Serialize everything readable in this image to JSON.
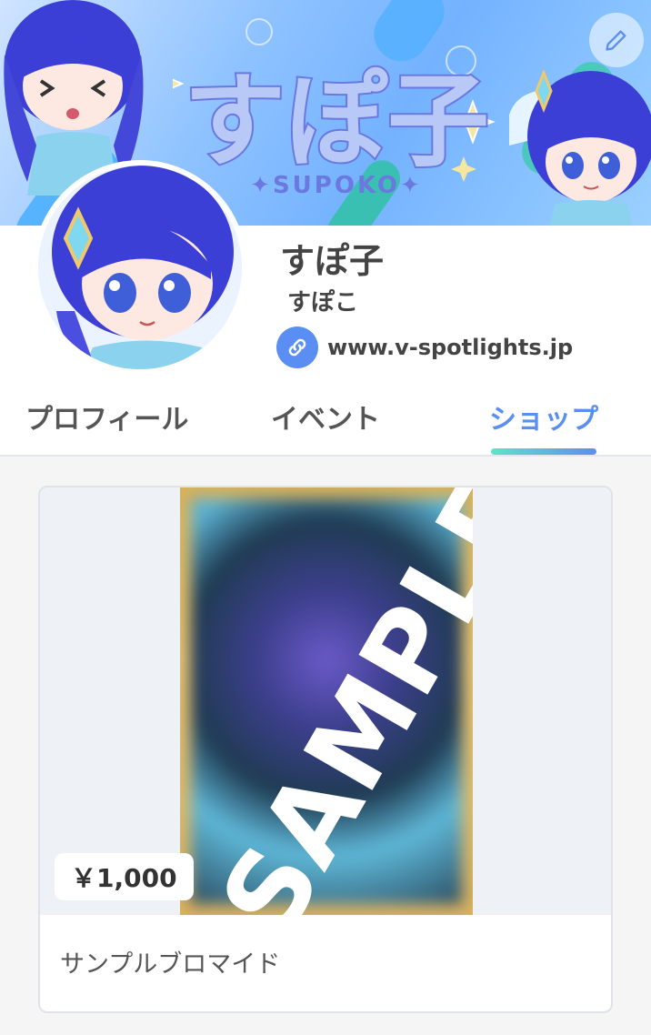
{
  "profile": {
    "display_name": "すぽ子",
    "handle": "すぽこ",
    "link": "www.v-spotlights.jp"
  },
  "banner": {
    "logo_title": "すぽ子",
    "logo_subtitle": "✦SUPOKO✦"
  },
  "tabs": [
    {
      "label": "プロフィール",
      "active": false
    },
    {
      "label": "イベント",
      "active": false
    },
    {
      "label": "ショップ",
      "active": true
    }
  ],
  "shop": {
    "items": [
      {
        "title": "サンプルブロマイド",
        "price": "￥1,000",
        "watermark": "SAMPLE"
      }
    ]
  },
  "colors": {
    "accent": "#5b8ef2",
    "tab_underline_start": "#5fe3c6",
    "tab_underline_end": "#5b8ef2"
  },
  "icons": {
    "edit": "pencil-icon",
    "link": "link-icon"
  }
}
